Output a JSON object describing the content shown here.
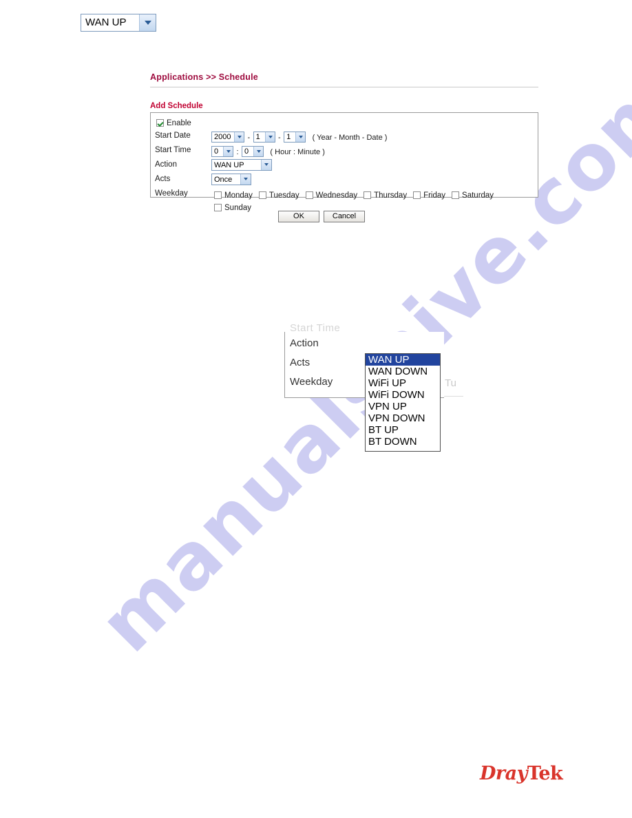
{
  "watermark": {
    "text": "manualshive.com"
  },
  "header": {
    "breadcrumb": "Applications >> Schedule"
  },
  "form": {
    "section_title": "Add Schedule",
    "enable": {
      "label": "Enable",
      "checked": true
    },
    "start_date": {
      "label": "Start Date",
      "year": "2000",
      "month": "1",
      "day": "1",
      "hint": "( Year - Month - Date )",
      "separator": "-"
    },
    "start_time": {
      "label": "Start Time",
      "hour": "0",
      "minute": "0",
      "hint": "( Hour : Minute )",
      "separator": ":"
    },
    "action": {
      "label": "Action",
      "value": "WAN UP"
    },
    "acts": {
      "label": "Acts",
      "value": "Once"
    },
    "weekday": {
      "label": "Weekday",
      "days": [
        {
          "label": "Monday",
          "checked": false
        },
        {
          "label": "Tuesday",
          "checked": false
        },
        {
          "label": "Wednesday",
          "checked": false
        },
        {
          "label": "Thursday",
          "checked": false
        },
        {
          "label": "Friday",
          "checked": false
        },
        {
          "label": "Saturday",
          "checked": false
        },
        {
          "label": "Sunday",
          "checked": false
        }
      ]
    }
  },
  "buttons": {
    "ok": "OK",
    "cancel": "Cancel"
  },
  "inset": {
    "ghost_label": "Start Time",
    "action_label": "Action",
    "acts_label": "Acts",
    "weekday_label": "Weekday",
    "selected_value": "WAN UP",
    "ghost_tuesday": "Tu",
    "options": [
      {
        "label": "WAN UP",
        "selected": true
      },
      {
        "label": "WAN DOWN",
        "selected": false
      },
      {
        "label": "WiFi UP",
        "selected": false
      },
      {
        "label": "WiFi DOWN",
        "selected": false
      },
      {
        "label": "VPN UP",
        "selected": false
      },
      {
        "label": "VPN DOWN",
        "selected": false
      },
      {
        "label": "BT UP",
        "selected": false
      },
      {
        "label": "BT DOWN",
        "selected": false
      }
    ]
  },
  "logo": {
    "dray": "Dray",
    "tek": "Tek"
  },
  "colors": {
    "breadcrumb": "#9e0b3e",
    "section_title": "#c00030",
    "selection_blue": "#21449e",
    "logo_red": "#d9342b",
    "watermark": "#cdcdf2"
  }
}
